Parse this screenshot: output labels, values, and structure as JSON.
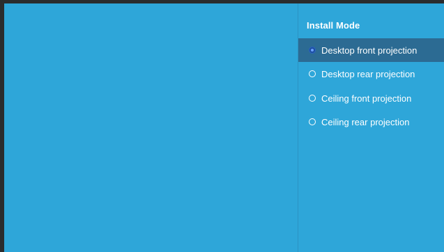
{
  "panel": {
    "title": "Install Mode",
    "options": [
      {
        "label": "Desktop front projection",
        "selected": true
      },
      {
        "label": "Desktop rear projection",
        "selected": false
      },
      {
        "label": "Ceiling front projection",
        "selected": false
      },
      {
        "label": "Ceiling rear projection",
        "selected": false
      }
    ]
  },
  "colors": {
    "background": "#2ea6d9",
    "selected_row": "#2c6b93",
    "frame": "#2a2c2e"
  }
}
